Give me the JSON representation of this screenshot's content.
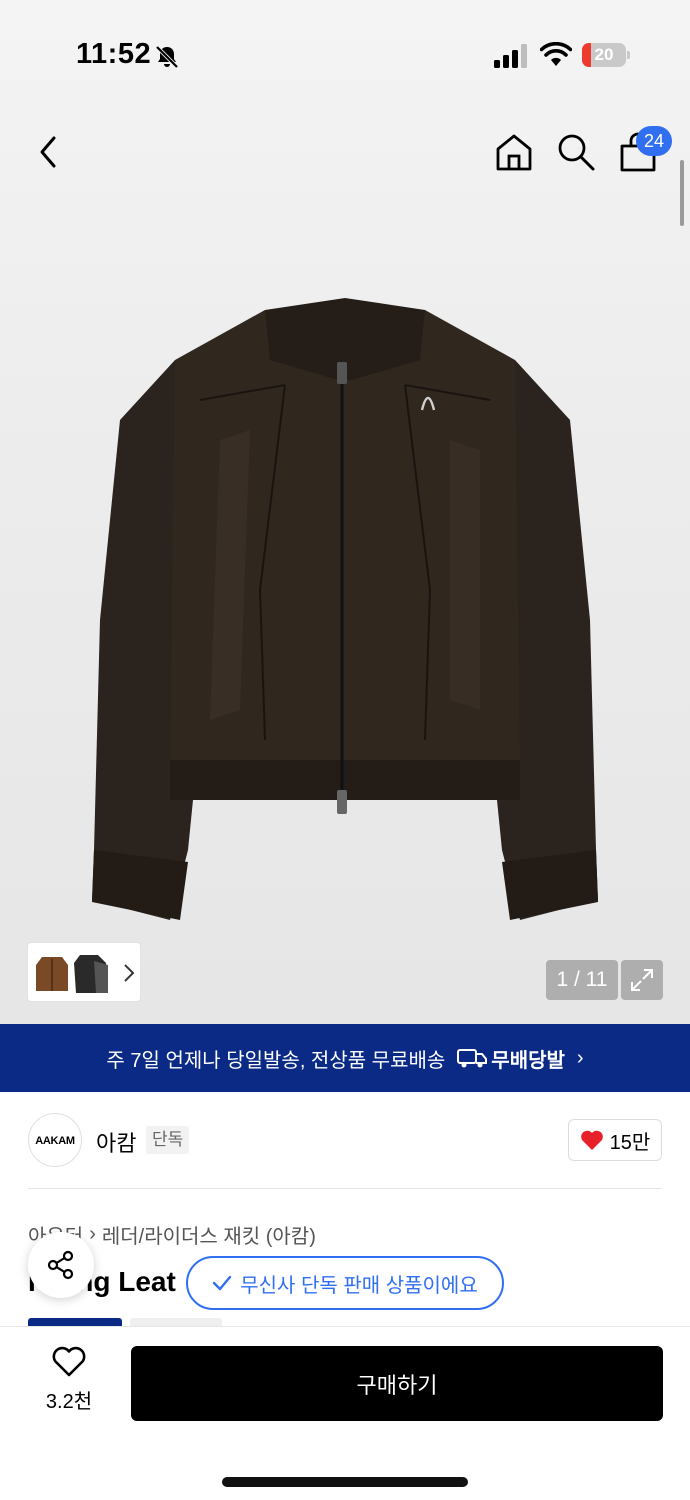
{
  "status_bar": {
    "time": "11:52",
    "battery_level": "20",
    "battery_fraction": 0.2
  },
  "nav": {
    "cart_count": "24"
  },
  "gallery": {
    "counter": "1 / 11"
  },
  "banner": {
    "text": "주 7일 언제나 당일발송, 전상품 무료배송",
    "badge": "무배당발",
    "chevron": "›"
  },
  "brand": {
    "logo_text": "AAKAM",
    "name": "아캄",
    "tag": "단독",
    "likes": "15만"
  },
  "breadcrumb": {
    "category": "아우터",
    "separator": "›",
    "subcategory": "레더/라이더스 재킷 (아캄)"
  },
  "product": {
    "title_fragment": "Flying Leat"
  },
  "exclusive_chip": {
    "text": "무신사 단독 판매 상품이에요"
  },
  "bottom_bar": {
    "wish_count": "3.2천",
    "buy_label": "구매하기"
  },
  "colors": {
    "accent_blue": "#2f6ff0",
    "banner_navy": "#0a2a86",
    "heart_red": "#e8202a",
    "jacket": "#2b231d"
  }
}
